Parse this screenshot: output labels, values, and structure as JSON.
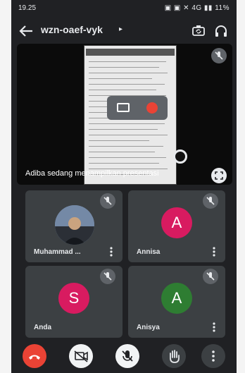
{
  "status_bar": {
    "time": "19.25",
    "system_indicators": "▣ ▣ ✕ 4G ▮▮ 11%"
  },
  "app_bar": {
    "meeting_code": "wzn-oaef-vyk",
    "meeting_chevron": "▸"
  },
  "presentation": {
    "caption": "Adiba sedang menampilkan presentasi"
  },
  "participants": [
    {
      "name": "Muhammad ...",
      "avatar": "photo",
      "muted": true
    },
    {
      "name": "Annisa",
      "avatar_letter": "A",
      "avatar_color": "#d81b60",
      "muted": true
    },
    {
      "name": "Anda",
      "avatar_letter": "S",
      "avatar_color": "#d81b60",
      "muted": true
    },
    {
      "name": "Anisya",
      "avatar_letter": "A",
      "avatar_color": "#2e7d32",
      "muted": true
    }
  ],
  "controls": {
    "end_call_color": "#ea4335",
    "light_button_color": "#f1f3f4",
    "dark_button_color": "#3c4043"
  },
  "icons": [
    "back-arrow-icon",
    "camera-switch-icon",
    "headphones-icon",
    "mic-off-icon",
    "fullscreen-icon",
    "more-vert-icon",
    "call-end-icon",
    "video-off-icon",
    "hand-raise-icon"
  ]
}
